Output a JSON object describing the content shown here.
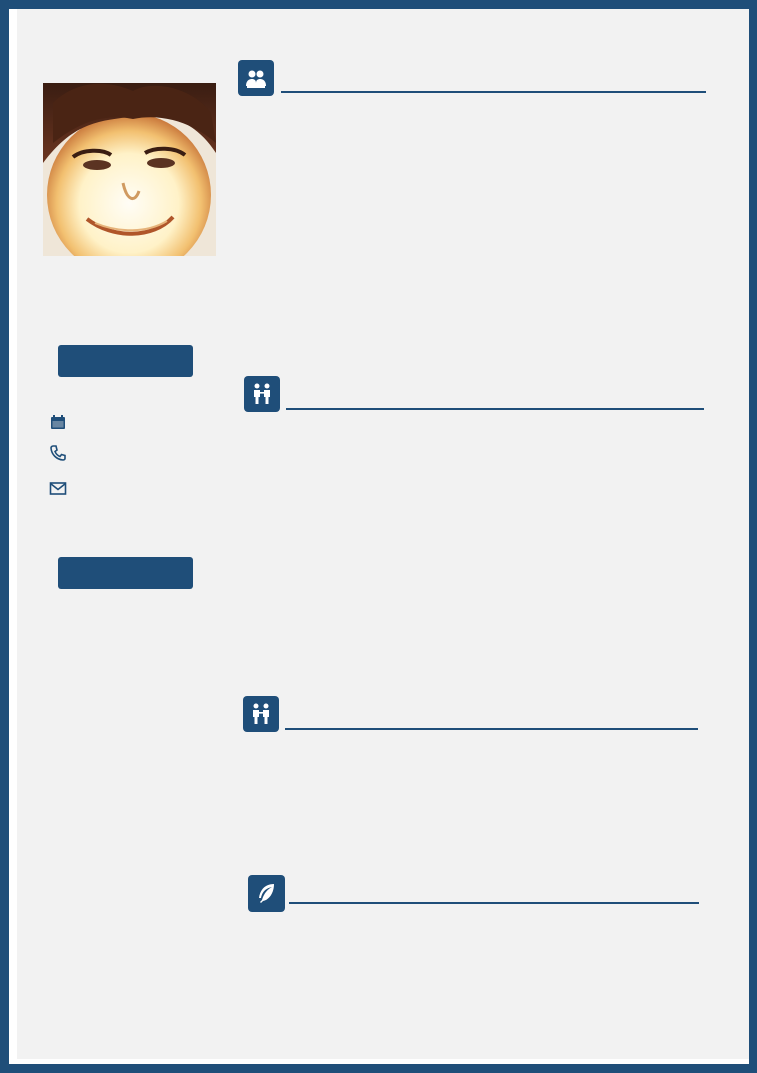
{
  "sidebar": {
    "photo": {
      "alt": ""
    },
    "contact_icons": [
      "calendar-icon",
      "phone-icon",
      "mail-icon"
    ],
    "pill_labels": [
      "",
      ""
    ]
  },
  "sections": [
    {
      "icon": "user-group-icon",
      "title": ""
    },
    {
      "icon": "people-icon",
      "title": ""
    },
    {
      "icon": "people-icon",
      "title": ""
    },
    {
      "icon": "feather-icon",
      "title": ""
    }
  ],
  "colors": {
    "accent": "#1f4e79",
    "background": "#f2f2f2"
  }
}
